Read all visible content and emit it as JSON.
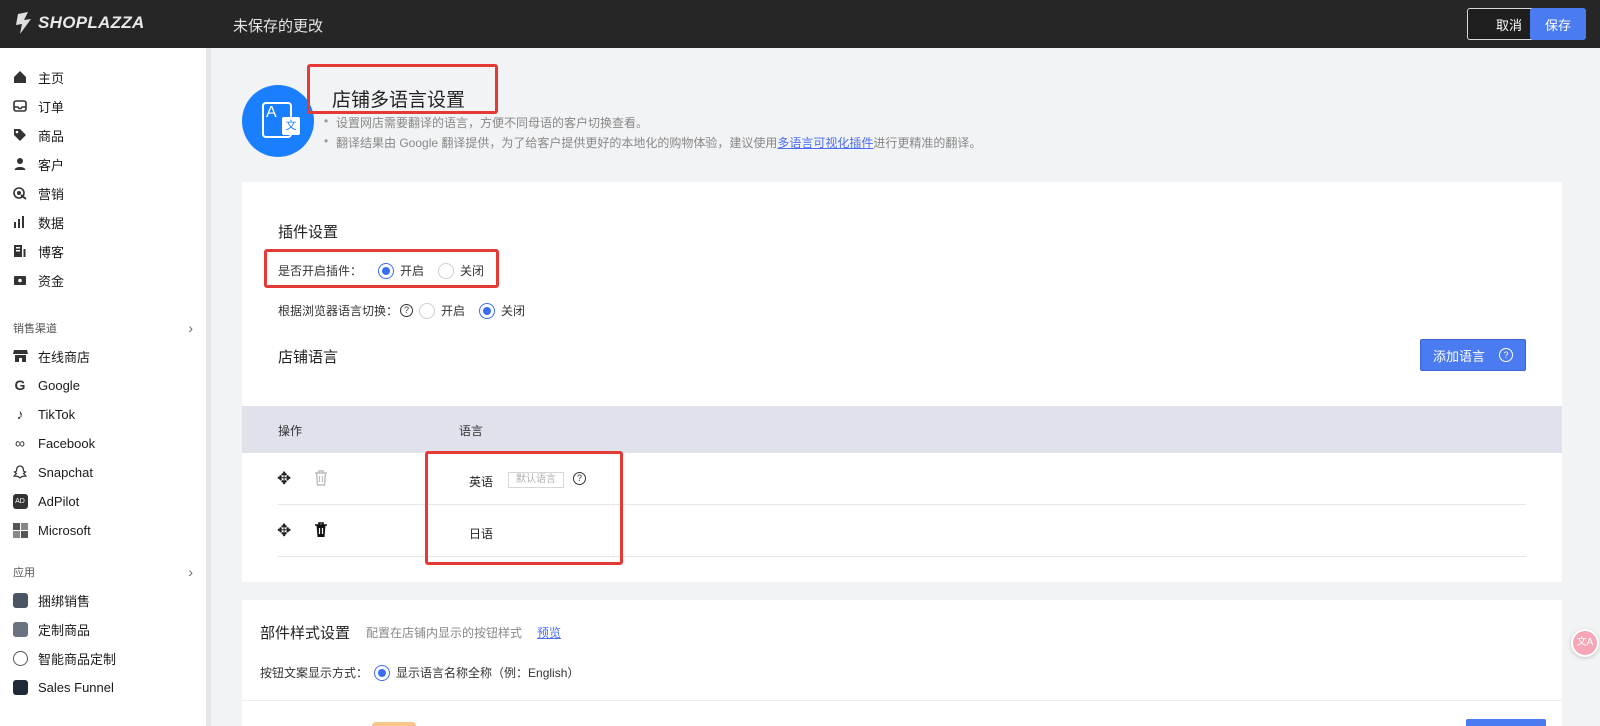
{
  "topbar": {
    "logo_text": "SHOPLAZZA",
    "status": "未保存的更改",
    "cancel_label": "取消",
    "save_label": "保存"
  },
  "sidebar": {
    "items": [
      {
        "label": "主页",
        "icon": "home-icon"
      },
      {
        "label": "订单",
        "icon": "inbox-icon"
      },
      {
        "label": "商品",
        "icon": "tag-icon"
      },
      {
        "label": "客户",
        "icon": "user-icon"
      },
      {
        "label": "营销",
        "icon": "target-icon"
      },
      {
        "label": "数据",
        "icon": "bar-chart-icon"
      },
      {
        "label": "博客",
        "icon": "blog-icon"
      },
      {
        "label": "资金",
        "icon": "wallet-icon"
      }
    ],
    "sales_section": "销售渠道",
    "channels": [
      {
        "label": "在线商店",
        "icon": "store-icon"
      },
      {
        "label": "Google",
        "icon": "google-icon"
      },
      {
        "label": "TikTok",
        "icon": "tiktok-icon"
      },
      {
        "label": "Facebook",
        "icon": "meta-icon"
      },
      {
        "label": "Snapchat",
        "icon": "snapchat-icon"
      },
      {
        "label": "AdPilot",
        "icon": "adpilot-icon"
      },
      {
        "label": "Microsoft",
        "icon": "microsoft-icon"
      }
    ],
    "apps_section": "应用",
    "apps": [
      {
        "label": "捆绑销售",
        "icon": "bundle-icon"
      },
      {
        "label": "定制商品",
        "icon": "custom-product-icon"
      },
      {
        "label": "智能商品定制",
        "icon": "smart-custom-icon"
      },
      {
        "label": "Sales Funnel",
        "icon": "funnel-icon"
      }
    ]
  },
  "page": {
    "title": "店铺多语言设置",
    "desc1": "设置网店需要翻译的语言，方便不同母语的客户切换查看。",
    "desc2_pre": "翻译结果由 Google 翻译提供，为了给客户提供更好的本地化的购物体验，建议使用",
    "desc2_link": "多语言可视化插件",
    "desc2_post": "进行更精准的翻译。"
  },
  "plugin": {
    "section_title": "插件设置",
    "enable_label": "是否开启插件：",
    "enable_on": "开启",
    "enable_off": "关闭",
    "enable_value": "开启",
    "browser_label": "根据浏览器语言切换：",
    "browser_on": "开启",
    "browser_off": "关闭",
    "browser_value": "关闭"
  },
  "languages": {
    "section_title": "店铺语言",
    "add_button": "添加语言",
    "columns": [
      "操作",
      "语言"
    ],
    "rows": [
      {
        "name": "英语",
        "tag": "默认语言",
        "deletable": false
      },
      {
        "name": "日语",
        "tag": "",
        "deletable": true
      }
    ]
  },
  "widget_style": {
    "title": "部件样式设置",
    "subtitle": "配置在店铺内显示的按钮样式",
    "preview_link": "预览",
    "display_label": "按钮文案显示方式：",
    "display_option": "显示语言名称全称（例：English）"
  },
  "colors": {
    "accent": "#4a7bf0",
    "highlight": "#e53935",
    "topbar": "#262626"
  }
}
